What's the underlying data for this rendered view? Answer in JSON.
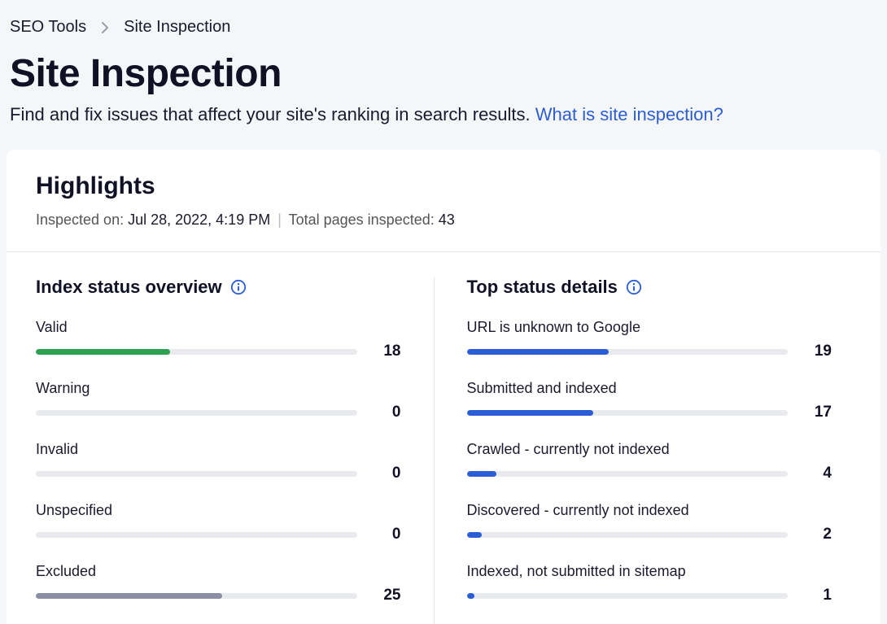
{
  "breadcrumb": {
    "parent": "SEO Tools",
    "current": "Site Inspection"
  },
  "page": {
    "title": "Site Inspection",
    "subtitle_text": "Find and fix issues that affect your site's ranking in search results. ",
    "subtitle_link": "What is site inspection?"
  },
  "highlights": {
    "title": "Highlights",
    "inspected_label": "Inspected on: ",
    "inspected_value": "Jul 28, 2022, 4:19 PM",
    "total_label": "Total pages inspected: ",
    "total_value": "43"
  },
  "index_status": {
    "title": "Index status overview",
    "max": 43,
    "items": [
      {
        "label": "Valid",
        "value": 18,
        "color": "green"
      },
      {
        "label": "Warning",
        "value": 0,
        "color": "gray"
      },
      {
        "label": "Invalid",
        "value": 0,
        "color": "gray"
      },
      {
        "label": "Unspecified",
        "value": 0,
        "color": "gray"
      },
      {
        "label": "Excluded",
        "value": 25,
        "color": "gray"
      }
    ]
  },
  "top_status": {
    "title": "Top status details",
    "max": 43,
    "items": [
      {
        "label": "URL is unknown to Google",
        "value": 19,
        "color": "blue"
      },
      {
        "label": "Submitted and indexed",
        "value": 17,
        "color": "blue"
      },
      {
        "label": "Crawled - currently not indexed",
        "value": 4,
        "color": "blue"
      },
      {
        "label": "Discovered - currently not indexed",
        "value": 2,
        "color": "blue"
      },
      {
        "label": "Indexed, not submitted in sitemap",
        "value": 1,
        "color": "blue"
      }
    ]
  },
  "chart_data": [
    {
      "type": "bar",
      "title": "Index status overview",
      "categories": [
        "Valid",
        "Warning",
        "Invalid",
        "Unspecified",
        "Excluded"
      ],
      "values": [
        18,
        0,
        0,
        0,
        25
      ],
      "xlabel": "",
      "ylabel": "",
      "ylim": [
        0,
        43
      ]
    },
    {
      "type": "bar",
      "title": "Top status details",
      "categories": [
        "URL is unknown to Google",
        "Submitted and indexed",
        "Crawled - currently not indexed",
        "Discovered - currently not indexed",
        "Indexed, not submitted in sitemap"
      ],
      "values": [
        19,
        17,
        4,
        2,
        1
      ],
      "xlabel": "",
      "ylabel": "",
      "ylim": [
        0,
        43
      ]
    }
  ]
}
